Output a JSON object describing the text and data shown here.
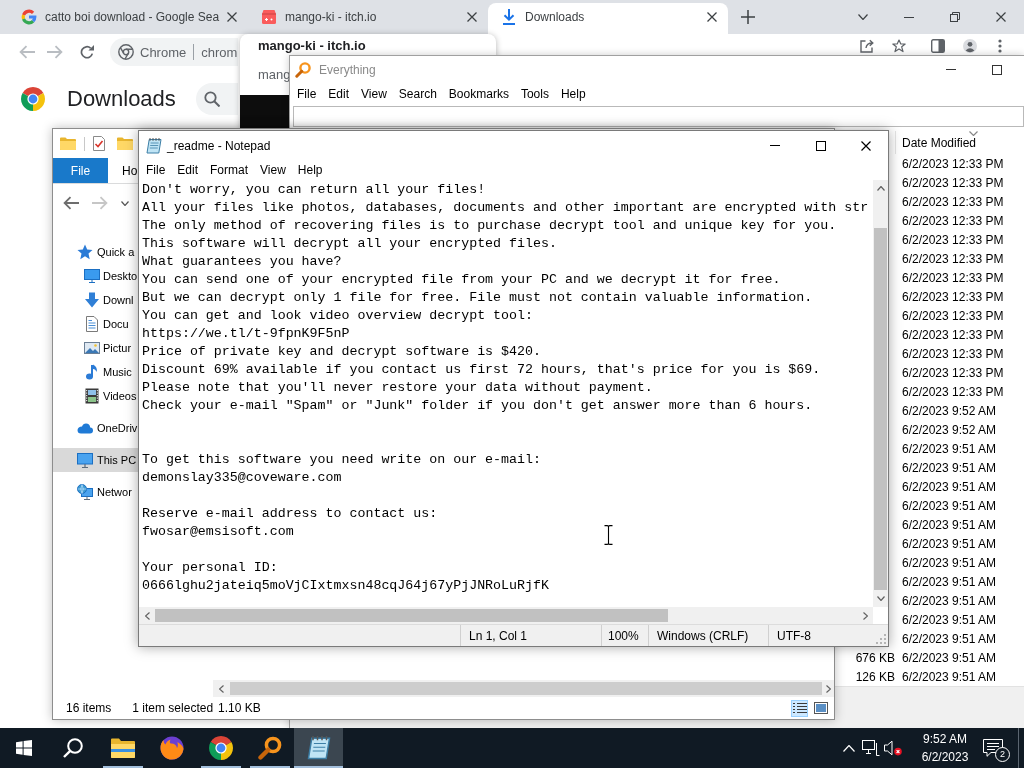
{
  "browser": {
    "tabs": [
      {
        "kind": "search",
        "title": "catto boi download - Google Sea",
        "selected": false
      },
      {
        "kind": "store",
        "title": "mango-ki - itch.io",
        "selected": false
      },
      {
        "kind": "download",
        "title": "Downloads",
        "selected": true
      }
    ],
    "nav_buttons": [
      {
        "kind": "back",
        "disabled": true
      },
      {
        "kind": "forward",
        "disabled": true
      },
      {
        "kind": "reload",
        "disabled": false
      }
    ],
    "address_bar": {
      "chip": "Chrome",
      "url": "chrom"
    },
    "page": {
      "heading": "Downloads"
    },
    "hover_card": {
      "title": "mango-ki - itch.io",
      "subtitle": "mang"
    }
  },
  "everything": {
    "title": "Everything",
    "menu": [
      "File",
      "Edit",
      "View",
      "Search",
      "Bookmarks",
      "Tools",
      "Help"
    ],
    "columns": [
      {
        "label": "Date Modified",
        "sorted": true
      }
    ],
    "rows": [
      {
        "date_modified": "6/2/2023 12:33 PM"
      },
      {
        "date_modified": "6/2/2023 12:33 PM"
      },
      {
        "date_modified": "6/2/2023 12:33 PM"
      },
      {
        "date_modified": "6/2/2023 12:33 PM"
      },
      {
        "date_modified": "6/2/2023 12:33 PM"
      },
      {
        "date_modified": "6/2/2023 12:33 PM"
      },
      {
        "date_modified": "6/2/2023 12:33 PM"
      },
      {
        "date_modified": "6/2/2023 12:33 PM"
      },
      {
        "date_modified": "6/2/2023 12:33 PM"
      },
      {
        "date_modified": "6/2/2023 12:33 PM"
      },
      {
        "date_modified": "6/2/2023 12:33 PM"
      },
      {
        "date_modified": "6/2/2023 12:33 PM"
      },
      {
        "date_modified": "6/2/2023 12:33 PM"
      },
      {
        "date_modified": "6/2/2023 9:52 AM"
      },
      {
        "date_modified": "6/2/2023 9:52 AM"
      },
      {
        "date_modified": "6/2/2023 9:51 AM"
      },
      {
        "date_modified": "6/2/2023 9:51 AM"
      },
      {
        "date_modified": "6/2/2023 9:51 AM"
      },
      {
        "date_modified": "6/2/2023 9:51 AM"
      },
      {
        "date_modified": "6/2/2023 9:51 AM"
      },
      {
        "date_modified": "6/2/2023 9:51 AM"
      },
      {
        "date_modified": "6/2/2023 9:51 AM"
      },
      {
        "date_modified": "6/2/2023 9:51 AM"
      },
      {
        "date_modified": "6/2/2023 9:51 AM"
      },
      {
        "date_modified": "6/2/2023 9:51 AM"
      },
      {
        "date_modified": "6/2/2023 9:51 AM"
      },
      {
        "size": "676 KB",
        "date_modified": "6/2/2023 9:51 AM"
      },
      {
        "size": "126 KB",
        "date_modified": "6/2/2023 9:51 AM"
      }
    ]
  },
  "explorer": {
    "ribbon_tabs": [
      {
        "kind": "file",
        "label": "File"
      },
      {
        "kind": "tab",
        "label": "Ho"
      }
    ],
    "nav_buttons": [
      {
        "kind": "back",
        "disabled": false
      },
      {
        "kind": "forward",
        "disabled": true
      }
    ],
    "nav_pane": [
      {
        "kind": "quick_access",
        "label": "Quick a",
        "selected": false,
        "children": [
          {
            "kind": "desktop",
            "label": "Deskto",
            "selected": false
          },
          {
            "kind": "downloads",
            "label": "Downl",
            "selected": false
          },
          {
            "kind": "documents",
            "label": "Docu",
            "selected": false
          },
          {
            "kind": "pictures",
            "label": "Pictur",
            "selected": false
          },
          {
            "kind": "music",
            "label": "Music",
            "selected": false
          },
          {
            "kind": "videos",
            "label": "Videos",
            "selected": false
          }
        ]
      },
      {
        "kind": "cloud",
        "label": "OneDriv",
        "selected": false
      },
      {
        "kind": "pc",
        "label": "This PC",
        "selected": true
      },
      {
        "kind": "network",
        "label": "Networ",
        "selected": false
      }
    ],
    "status": {
      "items": "16 items",
      "selected": "1 item selected",
      "size": "1.10 KB"
    },
    "views": [
      {
        "kind": "details",
        "selected": true
      },
      {
        "kind": "thumbnails",
        "selected": false
      }
    ]
  },
  "notepad": {
    "title": "_readme - Notepad",
    "menu": [
      "File",
      "Edit",
      "Format",
      "View",
      "Help"
    ],
    "lines": [
      {
        "kind": "text",
        "text": "Don't worry, you can return all your files!"
      },
      {
        "kind": "text",
        "text": "All your files like photos, databases, documents and other important are encrypted with str"
      },
      {
        "kind": "text",
        "text": "The only method of recovering files is to purchase decrypt tool and unique key for you."
      },
      {
        "kind": "text",
        "text": "This software will decrypt all your encrypted files."
      },
      {
        "kind": "text",
        "text": "What guarantees you have?"
      },
      {
        "kind": "text",
        "text": "You can send one of your encrypted file from your PC and we decrypt it for free."
      },
      {
        "kind": "text",
        "text": "But we can decrypt only 1 file for free. File must not contain valuable information."
      },
      {
        "kind": "text",
        "text": "You can get and look video overview decrypt tool:"
      },
      {
        "kind": "text",
        "text": "https://we.tl/t-9fpnK9F5nP"
      },
      {
        "kind": "text",
        "text": "Price of private key and decrypt software is $420."
      },
      {
        "kind": "text",
        "text": "Discount 69% available if you contact us first 72 hours, that's price for you is $69."
      },
      {
        "kind": "text",
        "text": "Please note that you'll never restore your data without payment."
      },
      {
        "kind": "text",
        "text": "Check your e-mail \"Spam\" or \"Junk\" folder if you don't get answer more than 6 hours."
      },
      {
        "kind": "blank"
      },
      {
        "kind": "blank"
      },
      {
        "kind": "text",
        "text": "To get this software you need write on our e-mail:"
      },
      {
        "kind": "text",
        "text": "demonslay335@coveware.com"
      },
      {
        "kind": "blank"
      },
      {
        "kind": "text",
        "text": "Reserve e-mail address to contact us:"
      },
      {
        "kind": "text",
        "text": "fwosar@emsisoft.com"
      },
      {
        "kind": "blank"
      },
      {
        "kind": "text",
        "text": "Your personal ID:"
      },
      {
        "kind": "text",
        "text": "0666lghu2jateiq5moVjCIxtmxsn48cqJ64j67yPjJNRoLuRjfK"
      }
    ],
    "status": [
      "Ln 1, Col 1",
      "100%",
      "Windows (CRLF)",
      "UTF-8"
    ]
  },
  "taskbar": {
    "apps": [
      {
        "kind": "explorer",
        "running": true,
        "active": false
      },
      {
        "kind": "firefox",
        "running": false,
        "active": false
      },
      {
        "kind": "chrome",
        "running": true,
        "active": false
      },
      {
        "kind": "everything",
        "running": true,
        "active": false
      },
      {
        "kind": "notepad",
        "running": true,
        "active": true
      }
    ],
    "tray": {
      "volume_muted": true,
      "time": "9:52 AM",
      "date": "6/2/2023",
      "notifications": "2"
    }
  }
}
